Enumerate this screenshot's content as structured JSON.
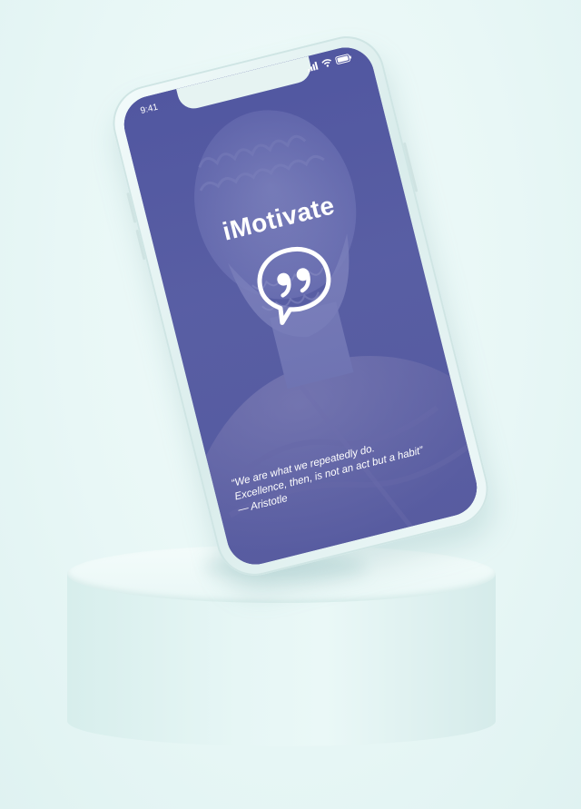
{
  "status_bar": {
    "time": "9:41"
  },
  "app": {
    "title": "iMotivate",
    "logo_icon": "quote-bubble-icon"
  },
  "quote": {
    "line1": "“We are what we repeatedly do.",
    "line2": "Excellence, then, is not an act but a habit”",
    "author": "— Aristotle"
  },
  "colors": {
    "tint": "#4e54a0",
    "background": "#e8f7f6",
    "pedestal": "#e6f6f5"
  }
}
